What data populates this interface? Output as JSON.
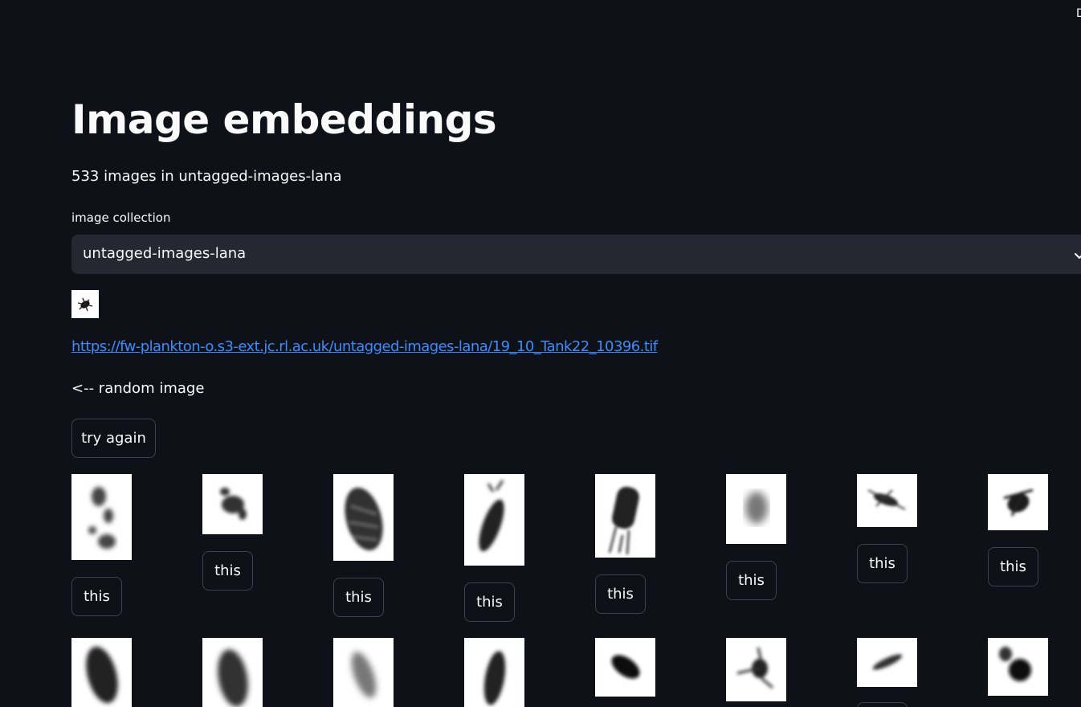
{
  "header": {
    "corner_glyph": "D"
  },
  "main": {
    "title": "Image embeddings",
    "count_text": "533 images in untagged-images-lana",
    "select": {
      "label": "image collection",
      "value": "untagged-images-lana"
    },
    "image_link": "https://fw-plankton-o.s3-ext.jc.rl.ac.uk/untagged-images-lana/19_10_Tank22_10396.tif",
    "random_text": "<-- random image",
    "try_again_label": "try again",
    "similar_button_label": "this"
  },
  "icons": {
    "select_chevron": "chevron-down-icon"
  },
  "colors": {
    "background": "#0e1117",
    "select_background": "#262730",
    "link": "#3d8bfd",
    "button_border": "#3e4250"
  }
}
